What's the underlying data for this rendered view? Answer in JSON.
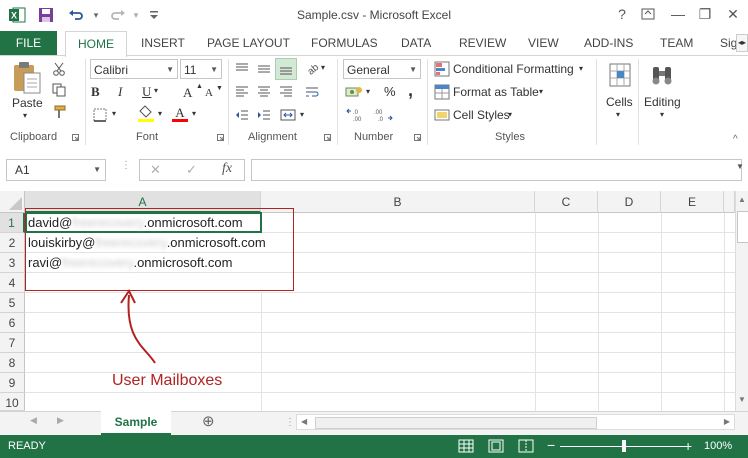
{
  "window": {
    "title": "Sample.csv - Microsoft Excel",
    "help": "?",
    "minimize": "—",
    "restore": "❐",
    "close": "✕"
  },
  "quick_access": {
    "redo_dropdown": "▾",
    "customize": "▾"
  },
  "tabs": {
    "file": "FILE",
    "home": "HOME",
    "insert": "INSERT",
    "page_layout": "PAGE LAYOUT",
    "formulas": "FORMULAS",
    "data": "DATA",
    "review": "REVIEW",
    "view": "VIEW",
    "add_ins": "ADD-INS",
    "team": "TEAM",
    "sign": "Sig"
  },
  "clipboard": {
    "paste": "Paste",
    "label": "Clipboard"
  },
  "font": {
    "name": "Calibri",
    "size": "11",
    "grow": "A",
    "shrink": "A",
    "bold": "B",
    "italic": "I",
    "underline": "U",
    "fill_color": "#ffff00",
    "font_color": "#ff0000",
    "label": "Font"
  },
  "alignment": {
    "label": "Alignment"
  },
  "number": {
    "format": "General",
    "currency": "$",
    "percent": "%",
    "comma": ",",
    "label": "Number"
  },
  "styles": {
    "conditional": "Conditional Formatting",
    "format_table": "Format as Table",
    "cell_styles": "Cell Styles",
    "label": "Styles"
  },
  "cells": {
    "label": "Cells"
  },
  "editing": {
    "label": "Editing"
  },
  "formula_bar": {
    "name_box": "A1",
    "cancel": "✕",
    "enter": "✓",
    "fx": "fx",
    "value": ""
  },
  "columns": [
    "A",
    "B",
    "C",
    "D",
    "E"
  ],
  "rows": [
    "1",
    "2",
    "3",
    "4",
    "5",
    "6",
    "7",
    "8",
    "9",
    "10"
  ],
  "cells_data": {
    "a1_pre": "david@",
    "a1_blur": "freerecovery",
    "a1_post": ".onmicrosoft.com",
    "a2_pre": "louiskirby@",
    "a2_blur": "freerecovery",
    "a2_post": ".onmicrosoft.com",
    "a3_pre": "ravi@",
    "a3_blur": "freerecovery",
    "a3_post": ".onmicrosoft.com"
  },
  "annotation": {
    "text": "User Mailboxes",
    "color": "#b22222"
  },
  "sheet": {
    "name": "Sample",
    "add": "⊕"
  },
  "status": {
    "ready": "READY",
    "zoom": "100%",
    "zoom_minus": "−",
    "zoom_plus": "+"
  },
  "colors": {
    "accent": "#217346"
  }
}
